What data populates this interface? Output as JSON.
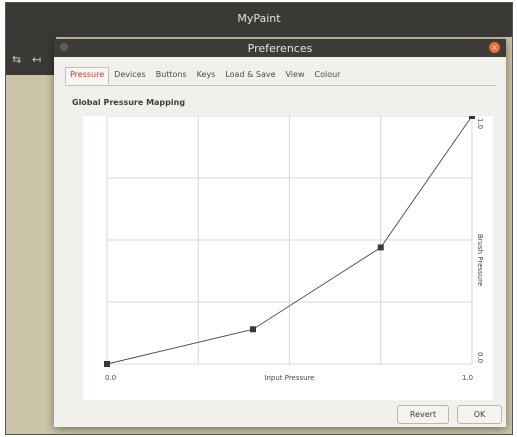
{
  "app": {
    "title": "MyPaint"
  },
  "dialog": {
    "title": "Preferences",
    "tabs": [
      {
        "label": "Pressure",
        "active": true
      },
      {
        "label": "Devices",
        "active": false
      },
      {
        "label": "Buttons",
        "active": false
      },
      {
        "label": "Keys",
        "active": false
      },
      {
        "label": "Load & Save",
        "active": false
      },
      {
        "label": "View",
        "active": false
      },
      {
        "label": "Colour",
        "active": false
      }
    ],
    "section_title": "Global Pressure Mapping",
    "curve": {
      "xlabel": "Input Pressure",
      "ylabel": "Brush Pressure",
      "x_min_label": "0.0",
      "x_max_label": "1.0",
      "y_min_label": "0.0",
      "y_max_label": "1.0",
      "points": [
        {
          "x": 0.0,
          "y": 0.0
        },
        {
          "x": 0.4,
          "y": 0.14
        },
        {
          "x": 0.75,
          "y": 0.47
        },
        {
          "x": 1.0,
          "y": 1.0
        }
      ]
    },
    "buttons": {
      "revert": "Revert",
      "ok": "OK"
    }
  },
  "colors": {
    "app_bar": "#3a3936",
    "canvas": "#cbc4a7",
    "active_tab_text": "#c0392b",
    "close_button": "#e86b3a"
  }
}
